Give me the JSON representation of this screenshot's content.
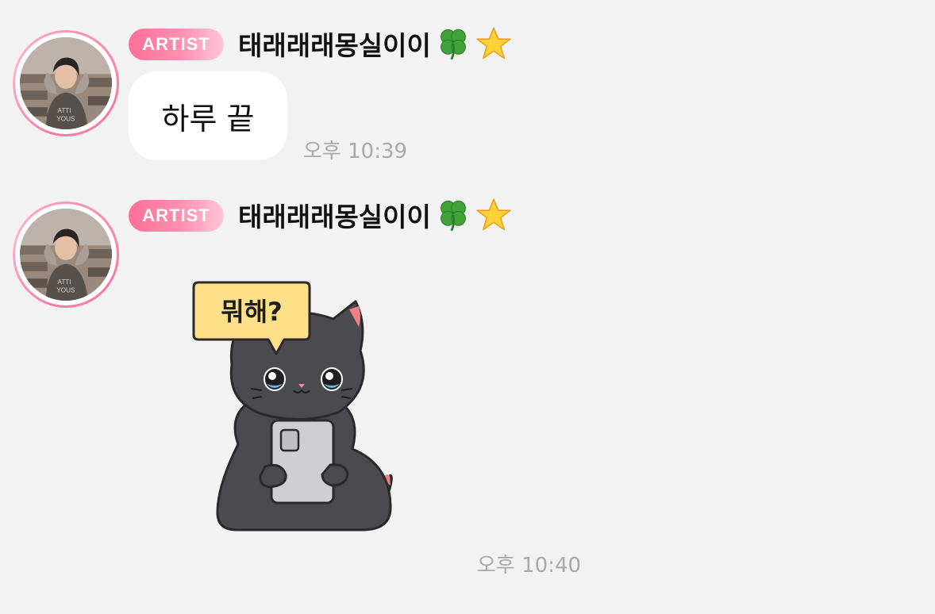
{
  "messages": [
    {
      "badge": "ARTIST",
      "sender": "태래래래몽실이이",
      "sender_emojis": [
        "four-leaf-clover-icon",
        "star-icon"
      ],
      "text": "하루 끝",
      "time": "오후 10:39"
    },
    {
      "badge": "ARTIST",
      "sender": "태래래래몽실이이",
      "sender_emojis": [
        "four-leaf-clover-icon",
        "star-icon"
      ],
      "sticker_text": "뭐해?",
      "time": "오후 10:40"
    }
  ],
  "colors": {
    "background": "#f2f2f2",
    "badge_pink": "#ff6f98",
    "bubble": "#ffffff",
    "timestamp": "#a9a9a9",
    "sticker_cat": "#4b4b4f",
    "sticker_speech": "#ffe08a"
  }
}
